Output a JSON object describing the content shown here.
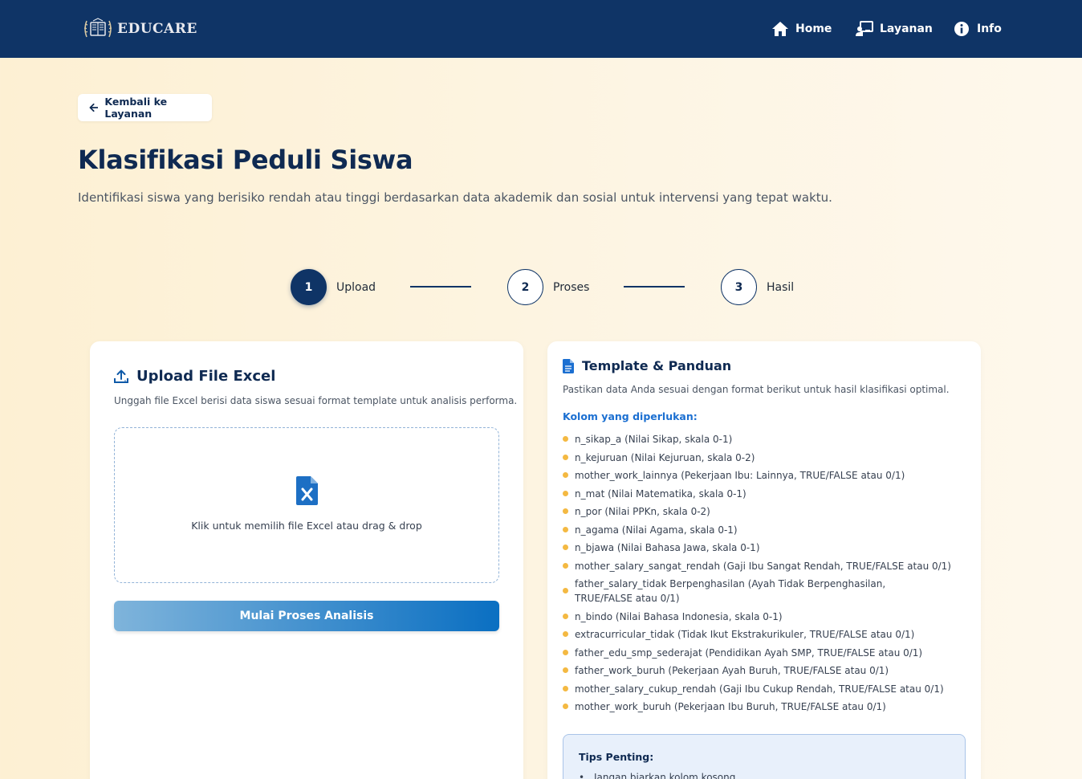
{
  "nav": {
    "brand": "EDUCARE",
    "items": [
      {
        "label": "Home",
        "icon": "home-icon"
      },
      {
        "label": "Layanan",
        "icon": "chalkboard-user-icon"
      },
      {
        "label": "Info",
        "icon": "info-circle-icon"
      }
    ]
  },
  "back_button": {
    "label": "Kembali ke Layanan",
    "icon": "arrow-left-icon"
  },
  "header": {
    "title": "Klasifikasi Peduli Siswa",
    "subtitle": "Identifikasi siswa yang berisiko rendah atau tinggi berdasarkan data akademik dan sosial untuk intervensi yang tepat waktu."
  },
  "steps": [
    {
      "number": "1",
      "label": "Upload",
      "active": true
    },
    {
      "number": "2",
      "label": "Proses",
      "active": false
    },
    {
      "number": "3",
      "label": "Hasil",
      "active": false
    }
  ],
  "upload": {
    "title": "Upload File Excel",
    "description": "Unggah file Excel berisi data siswa sesuai format template untuk analisis performa.",
    "dropzone_text": "Klik untuk memilih file Excel atau drag & drop",
    "start_button": "Mulai Proses Analisis"
  },
  "template": {
    "title": "Template & Panduan",
    "description": "Pastikan data Anda sesuai dengan format berikut untuk hasil klasifikasi optimal.",
    "columns_label": "Kolom yang diperlukan:",
    "columns": [
      "n_sikap_a (Nilai Sikap, skala 0-1)",
      "n_kejuruan (Nilai Kejuruan, skala 0-2)",
      "mother_work_lainnya (Pekerjaan Ibu: Lainnya, TRUE/FALSE atau 0/1)",
      "n_mat (Nilai Matematika, skala 0-1)",
      "n_por (Nilai PPKn, skala 0-2)",
      "n_agama (Nilai Agama, skala 0-1)",
      "n_bjawa (Nilai Bahasa Jawa, skala 0-1)",
      "mother_salary_sangat_rendah (Gaji Ibu Sangat Rendah, TRUE/FALSE atau 0/1)",
      "father_salary_tidak Berpenghasilan (Ayah Tidak Berpenghasilan, TRUE/FALSE atau 0/1)",
      "n_bindo (Nilai Bahasa Indonesia, skala 0-1)",
      "extracurricular_tidak (Tidak Ikut Ekstrakurikuler, TRUE/FALSE atau 0/1)",
      "father_edu_smp_sederajat (Pendidikan Ayah SMP, TRUE/FALSE atau 0/1)",
      "father_work_buruh (Pekerjaan Ayah Buruh, TRUE/FALSE atau 0/1)",
      "mother_salary_cukup_rendah (Gaji Ibu Cukup Rendah, TRUE/FALSE atau 0/1)",
      "mother_work_buruh (Pekerjaan Ibu Buruh, TRUE/FALSE atau 0/1)"
    ],
    "tips_title": "Tips Penting:",
    "tips": [
      "Jangan biarkan kolom kosong"
    ]
  },
  "colors": {
    "navbar": "#0f3466",
    "primary_text": "#0f2a52",
    "bullet": "#f4b942",
    "link_label": "#1b6fd1"
  }
}
